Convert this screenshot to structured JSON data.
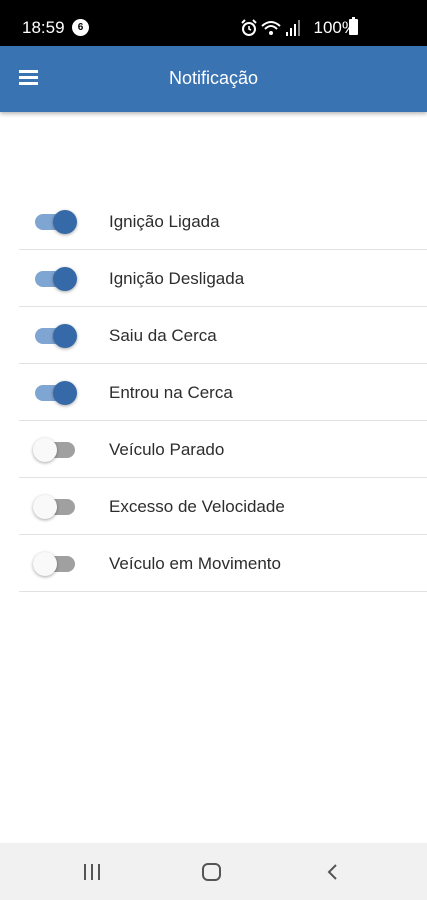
{
  "status_bar": {
    "time": "18:59",
    "notification_badge": "6",
    "battery": "100%",
    "icons": [
      "alarm-icon",
      "wifi-icon",
      "signal-icon",
      "battery-icon"
    ]
  },
  "app_bar": {
    "title": "Notificação",
    "menu_icon": "hamburger-menu-icon",
    "color": "#3a73b2"
  },
  "notifications": [
    {
      "label": "Ignição Ligada",
      "enabled": true
    },
    {
      "label": "Ignição Desligada",
      "enabled": true
    },
    {
      "label": "Saiu da Cerca",
      "enabled": true
    },
    {
      "label": "Entrou na Cerca",
      "enabled": true
    },
    {
      "label": "Veículo Parado",
      "enabled": false
    },
    {
      "label": "Excesso de Velocidade",
      "enabled": false
    },
    {
      "label": "Veículo em Movimento",
      "enabled": false
    }
  ],
  "nav_bar": {
    "buttons": [
      "recents-icon",
      "home-icon",
      "back-icon"
    ]
  }
}
